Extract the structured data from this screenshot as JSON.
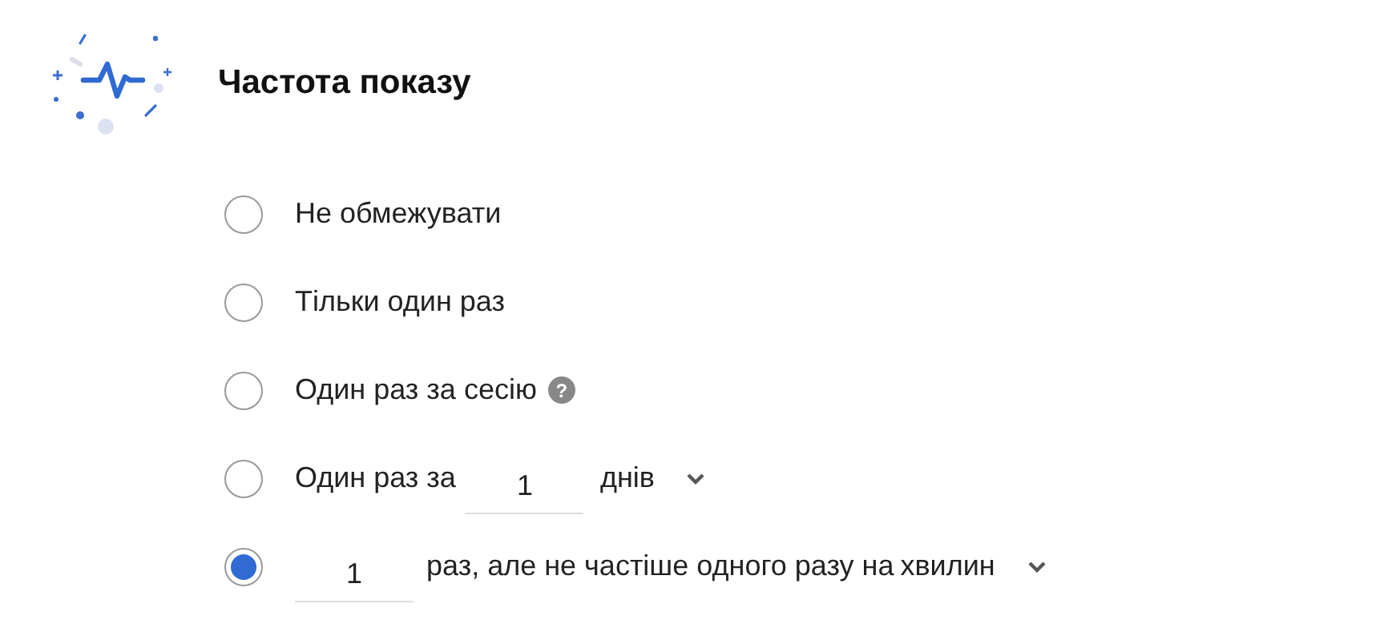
{
  "section": {
    "title": "Частота показу"
  },
  "options": [
    {
      "kind": "text",
      "label": "Не обмежувати",
      "selected": false
    },
    {
      "kind": "text",
      "label": "Тільки один раз",
      "selected": false
    },
    {
      "kind": "help",
      "label": "Один раз за сесію",
      "help_icon": "?",
      "selected": false
    },
    {
      "kind": "period",
      "label": "Один раз за",
      "value": "1",
      "unit": "днів",
      "selected": false
    },
    {
      "kind": "rate",
      "value": "1",
      "label": "раз, але не частіше одного разу на",
      "unit": "хвилин",
      "selected": true
    }
  ]
}
